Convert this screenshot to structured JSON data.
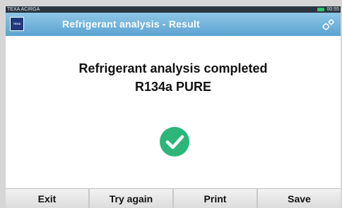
{
  "status_bar": {
    "left_text": "TEXA ACIRGA",
    "time": "00:55"
  },
  "header": {
    "brand_text": "TEXA",
    "title": "Refrigerant analysis - Result",
    "settings_icon": "settings-icon"
  },
  "main": {
    "line1": "Refrigerant analysis completed",
    "line2": "R134a PURE",
    "status_icon": "check-circle-icon",
    "status_color": "#2db67a"
  },
  "footer": {
    "buttons": [
      {
        "label": "Exit"
      },
      {
        "label": "Try again"
      },
      {
        "label": "Print"
      },
      {
        "label": "Save"
      }
    ]
  }
}
